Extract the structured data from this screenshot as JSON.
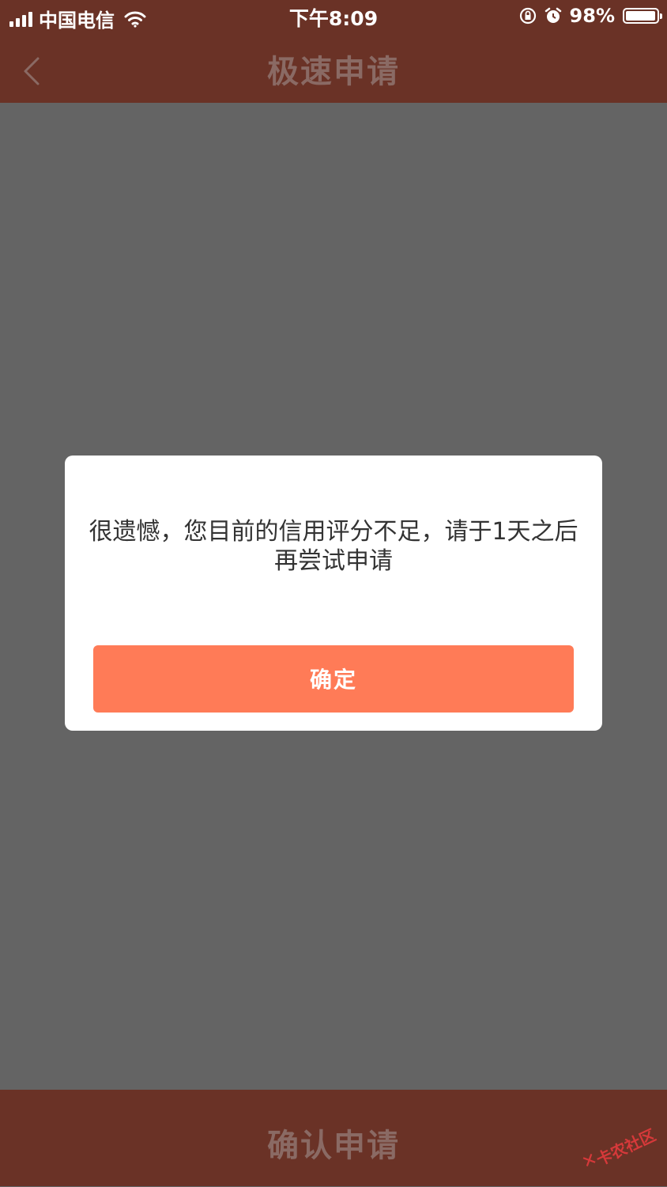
{
  "status_bar": {
    "carrier": "中国电信",
    "time": "下午8:09",
    "battery_percent": "98%",
    "battery_level": 0.98,
    "icons": [
      "signal-icon",
      "wifi-icon",
      "orientation-lock-icon",
      "alarm-icon",
      "battery-icon"
    ]
  },
  "nav": {
    "title": "极速申请",
    "back_icon": "chevron-left-icon"
  },
  "dialog": {
    "message": "很遗憾，您目前的信用评分不足，请于1天之后再尝试申请",
    "ok_label": "确定"
  },
  "bottom_bar": {
    "action_label": "确认申请"
  },
  "watermark": {
    "text": "卡农社区"
  },
  "colors": {
    "brand_dimmed": "#6a3226",
    "overlay": "#646464",
    "button": "#ff7b57"
  }
}
